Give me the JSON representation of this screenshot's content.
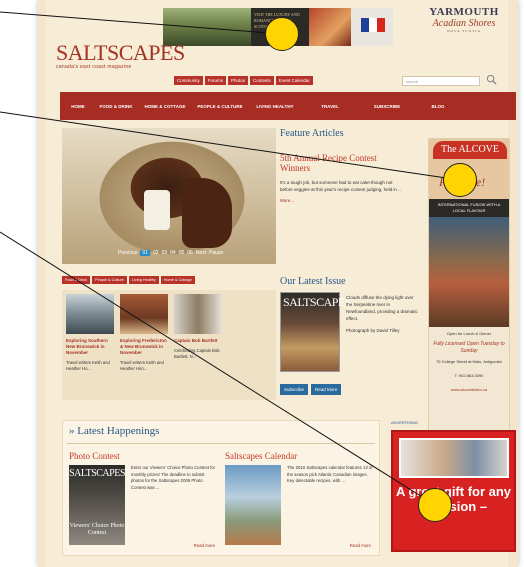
{
  "banner": {
    "ad_text": "VISIT THE LUXURY AND ROMANCE OF NOVA SCOTIA",
    "yarmouth": "YARMOUTH",
    "acadian": "Acadian Shores",
    "region_line": "NOVA SCOTIA"
  },
  "brand": {
    "logo": "SALTSCAPES",
    "tagline": "canada's east coast magazine"
  },
  "subnav": [
    "Community",
    "Forums",
    "Photos",
    "Contests",
    "Event Calendar"
  ],
  "search": {
    "placeholder": "search"
  },
  "mainnav": [
    "HOME",
    "FOOD & DRINK",
    "HOME & COTTAGE",
    "PEOPLE & CULTURE",
    "LIVING HEALTHY",
    "TRAVEL",
    "SUBSCRIBE",
    "BLOG"
  ],
  "slideshow": {
    "previous": "Previous",
    "pages": [
      "01",
      "02",
      "03",
      "04",
      "05",
      "06"
    ],
    "next": "Next",
    "pause": "Pause"
  },
  "feature": {
    "heading": "Feature Articles",
    "title": "5th Annual Recipe Contest Winners",
    "summary": "It's a tough job, but someone had to eat cake-though not before veggies-at this year's recipe contest judging, held in ...",
    "more": "More..."
  },
  "ad_right": {
    "name": "The ALCOVE",
    "pleasure": "Pleasure!",
    "strip": "INTERNATIONAL FUSION WITH A LOCAL FLAVOUR",
    "hours": "Open for Lunch & Dinner",
    "licensed": "Fully Licensed Open Tuesday to Sunday",
    "address": "79 College Street at Main, Antigonish",
    "phone": "T: 902.863.3590",
    "url": "www.alcovebistro.ca"
  },
  "tabs": [
    "Food & Drink",
    "People & Culture",
    "Living Healthy",
    "Home & Cottage"
  ],
  "thumbs": [
    {
      "title": "Exploring Southern New Brunswick in November",
      "text": "Travel writers Keith and Heather Ho..."
    },
    {
      "title": "Exploring Fredericton & New Brunswick in November",
      "text": "Travel writers Keith and Heather Hiro..."
    },
    {
      "title": "Captain Bob Bartlett",
      "text": "Celebrating Captain Bob Bartlett, N..."
    }
  ],
  "issue": {
    "heading": "Our Latest Issue",
    "cover_title": "SALTSCAPES",
    "caption": "Clouds diffuse the dying light over the Serpentine river in Newfoundland, providing a dramatic effect.",
    "photo_credit": "Photograph by David Tilley",
    "subscribe": "Subscribe",
    "read_more": "Read More"
  },
  "happenings": {
    "heading": "Latest Happenings",
    "cards": [
      {
        "title": "Photo Contest",
        "cover": "SALTSCAPES",
        "cover_sub": "Viewers' Choice Photo Contest",
        "text": "Enter our Viewers' Choice Photo Contest for monthly prizes! The deadline to submit photos for the Saltscapes 2009 Photo Contest was ...",
        "more": "Read more"
      },
      {
        "title": "Saltscapes Calendar",
        "text": "The 2010 Saltscapes calendar features 13 of the season pick Atlantic Canadian images. Key delectable recipes, with ...",
        "more": "Read more"
      }
    ]
  },
  "ad_bottom": {
    "label": "ADVERTISING",
    "text": "A great gift for any occasion –"
  },
  "colors": {
    "brand_red": "#a72c24",
    "heading_blue": "#26588a",
    "marker_yellow": "#ffd400"
  }
}
